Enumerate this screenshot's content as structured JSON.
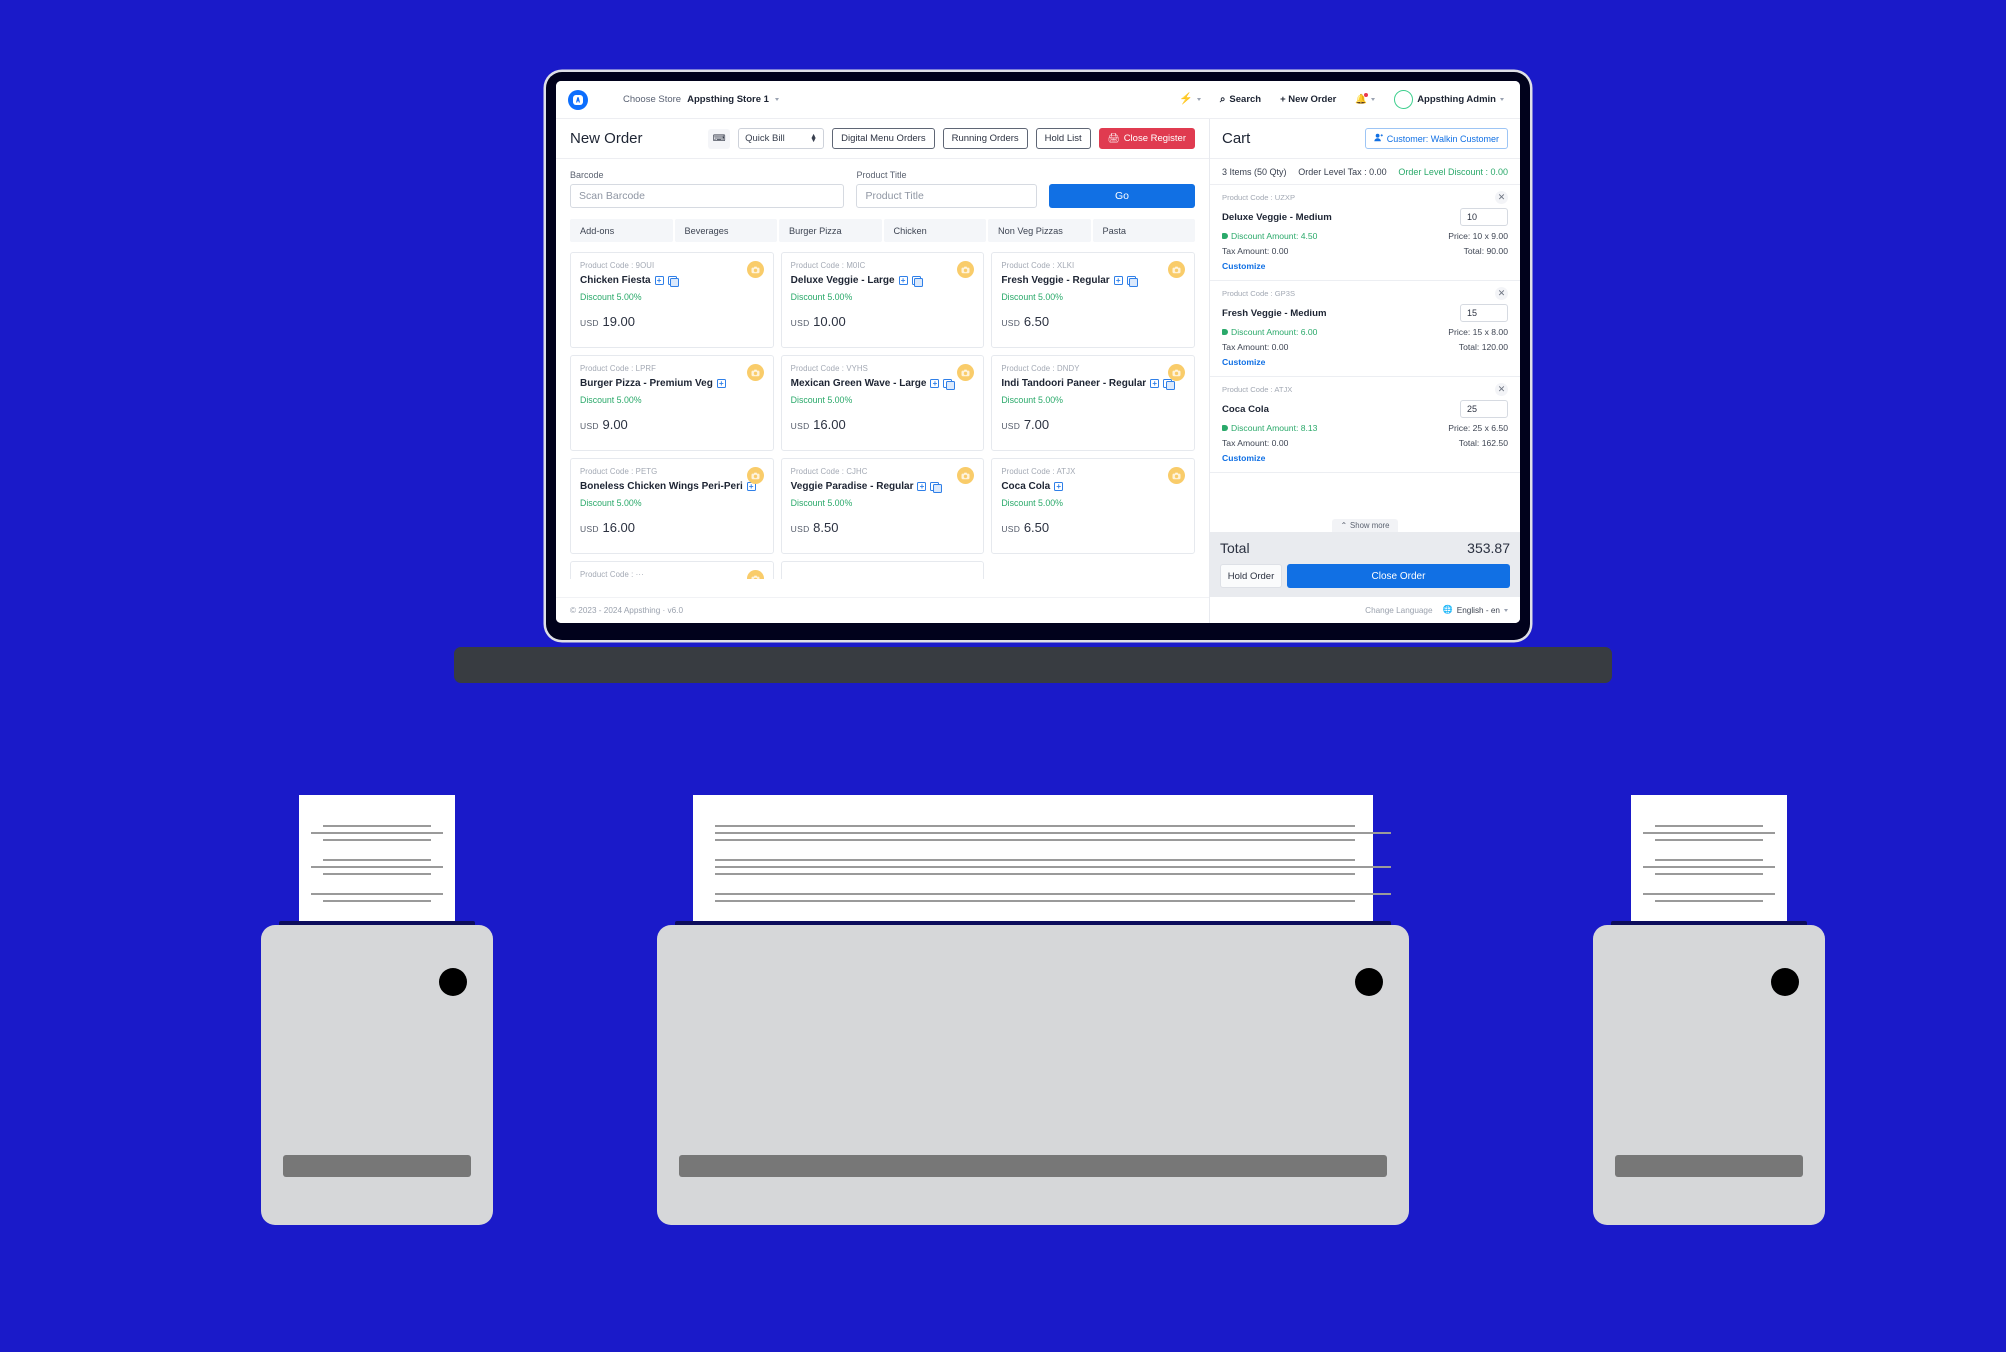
{
  "brand": {
    "logo_icon": "appsthing-logo-icon"
  },
  "topbar": {
    "choose_store_label": "Choose Store",
    "store_name": "Appsthing Store 1",
    "bolt_icon": "bolt-icon",
    "search_label": "Search",
    "search_icon": "search-icon",
    "new_order_label": "+ New Order",
    "bell_icon": "bell-icon",
    "user_name": "Appsthing Admin",
    "avatar_icon": "user-avatar-icon"
  },
  "order_toolbar": {
    "page_title": "New Order",
    "keyboard_icon": "keyboard-icon",
    "bill_type": "Quick Bill",
    "bill_type_options": [
      "Quick Bill"
    ],
    "digital_menu_orders": "Digital Menu Orders",
    "running_orders": "Running Orders",
    "hold_list": "Hold List",
    "close_register": "Close Register",
    "close_register_icon": "register-icon"
  },
  "search": {
    "barcode_label": "Barcode",
    "barcode_placeholder": "Scan Barcode",
    "barcode_value": "",
    "product_title_label": "Product Title",
    "product_title_placeholder": "Product Title",
    "product_title_value": "",
    "go_label": "Go"
  },
  "categories": [
    {
      "label": "Add-ons"
    },
    {
      "label": "Beverages"
    },
    {
      "label": "Burger Pizza"
    },
    {
      "label": "Chicken"
    },
    {
      "label": "Non Veg Pizzas"
    },
    {
      "label": "Pasta"
    }
  ],
  "products": [
    {
      "code_label": "Product Code : 9OUI",
      "name": "Chicken Fiesta",
      "discount": "Discount 5.00%",
      "currency": "USD",
      "price": "19.00",
      "has_copy": true,
      "image_icon": "camera-icon"
    },
    {
      "code_label": "Product Code : M0IC",
      "name": "Deluxe Veggie - Large",
      "discount": "Discount 5.00%",
      "currency": "USD",
      "price": "10.00",
      "has_copy": true,
      "image_icon": "camera-icon"
    },
    {
      "code_label": "Product Code : XLKI",
      "name": "Fresh Veggie - Regular",
      "discount": "Discount 5.00%",
      "currency": "USD",
      "price": "6.50",
      "has_copy": true,
      "image_icon": "camera-icon"
    },
    {
      "code_label": "Product Code : LPRF",
      "name": "Burger Pizza - Premium Veg",
      "discount": "Discount 5.00%",
      "currency": "USD",
      "price": "9.00",
      "has_copy": false,
      "image_icon": "camera-icon"
    },
    {
      "code_label": "Product Code : VYHS",
      "name": "Mexican Green Wave - Large",
      "discount": "Discount 5.00%",
      "currency": "USD",
      "price": "16.00",
      "has_copy": true,
      "image_icon": "camera-icon"
    },
    {
      "code_label": "Product Code : DNDY",
      "name": "Indi Tandoori Paneer - Regular",
      "discount": "Discount 5.00%",
      "currency": "USD",
      "price": "7.00",
      "has_copy": true,
      "image_icon": "camera-icon"
    },
    {
      "code_label": "Product Code : PETG",
      "name": "Boneless Chicken Wings Peri-Peri",
      "discount": "Discount 5.00%",
      "currency": "USD",
      "price": "16.00",
      "has_copy": false,
      "image_icon": "camera-icon"
    },
    {
      "code_label": "Product Code : CJHC",
      "name": "Veggie Paradise - Regular",
      "discount": "Discount 5.00%",
      "currency": "USD",
      "price": "8.50",
      "has_copy": true,
      "image_icon": "camera-icon"
    },
    {
      "code_label": "Product Code : ATJX",
      "name": "Coca Cola",
      "discount": "Discount 5.00%",
      "currency": "USD",
      "price": "6.50",
      "has_copy": false,
      "image_icon": "camera-icon"
    }
  ],
  "footer": {
    "copyright": "© 2023 - 2024 Appsthing · v6.0"
  },
  "cart": {
    "title": "Cart",
    "customer_button": "Customer: Walkin Customer",
    "customer_icon": "customer-icon",
    "items_count": "3 Items (50 Qty)",
    "order_level_tax": "Order Level Tax : 0.00",
    "order_level_discount": "Order Level Discount : 0.00",
    "show_more": "Show more",
    "show_more_icon": "chevron-up-icon",
    "total_label": "Total",
    "total_value": "353.87",
    "hold_order": "Hold Order",
    "close_order": "Close Order",
    "remove_icon": "close-icon",
    "items": [
      {
        "code_label": "Product Code : UZXP",
        "name": "Deluxe Veggie - Medium",
        "qty": "10",
        "discount": "Discount Amount: 4.50",
        "price": "Price: 10 x 9.00",
        "tax": "Tax Amount: 0.00",
        "total": "Total: 90.00",
        "customize": "Customize"
      },
      {
        "code_label": "Product Code : GP3S",
        "name": "Fresh Veggie - Medium",
        "qty": "15",
        "discount": "Discount Amount: 6.00",
        "price": "Price: 15 x 8.00",
        "tax": "Tax Amount: 0.00",
        "total": "Total: 120.00",
        "customize": "Customize"
      },
      {
        "code_label": "Product Code : ATJX",
        "name": "Coca Cola",
        "qty": "25",
        "discount": "Discount Amount: 8.13",
        "price": "Price: 25 x 6.50",
        "tax": "Tax Amount: 0.00",
        "total": "Total: 162.50",
        "customize": "Customize"
      }
    ]
  },
  "language_bar": {
    "change_language_label": "Change Language",
    "globe_icon": "globe-icon",
    "current_language": "English - en"
  },
  "colors": {
    "page_background": "#1a1ac9",
    "primary": "#1170e4",
    "danger": "#e03b50",
    "success": "#2aa96a",
    "bezel": "#01021c",
    "stand": "#383c41"
  }
}
